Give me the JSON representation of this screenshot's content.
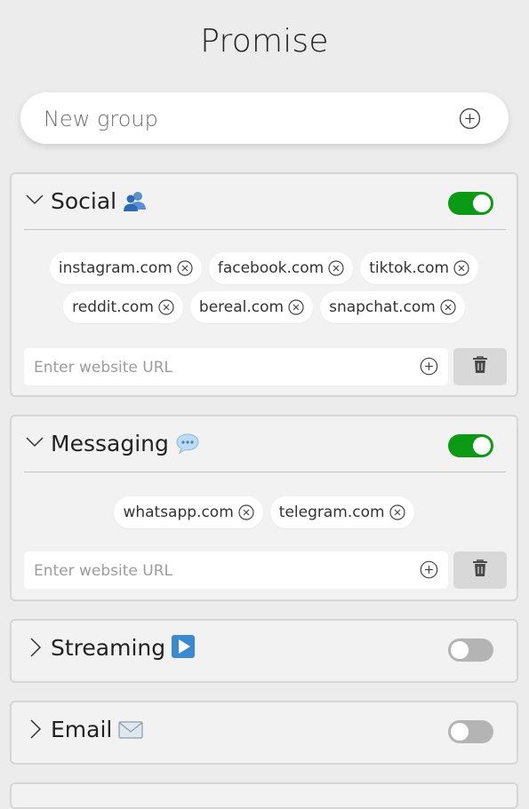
{
  "app": {
    "title": "Promise"
  },
  "new_group": {
    "placeholder": "New group"
  },
  "groups": [
    {
      "name": "Social",
      "emoji": "people-icon",
      "enabled": true,
      "expanded": true,
      "sites": [
        "instagram.com",
        "facebook.com",
        "tiktok.com",
        "reddit.com",
        "bereal.com",
        "snapchat.com"
      ],
      "url_placeholder": "Enter website URL"
    },
    {
      "name": "Messaging",
      "emoji": "speech-bubble-icon",
      "enabled": true,
      "expanded": true,
      "sites": [
        "whatsapp.com",
        "telegram.com"
      ],
      "url_placeholder": "Enter website URL"
    },
    {
      "name": "Streaming",
      "emoji": "play-button-icon",
      "enabled": false,
      "expanded": false
    },
    {
      "name": "Email",
      "emoji": "envelope-icon",
      "enabled": false,
      "expanded": false
    }
  ],
  "colors": {
    "toggle_on": "#0b9a14",
    "toggle_off": "#b4b4b4",
    "background": "#ececec",
    "card": "#f2f2f2"
  }
}
